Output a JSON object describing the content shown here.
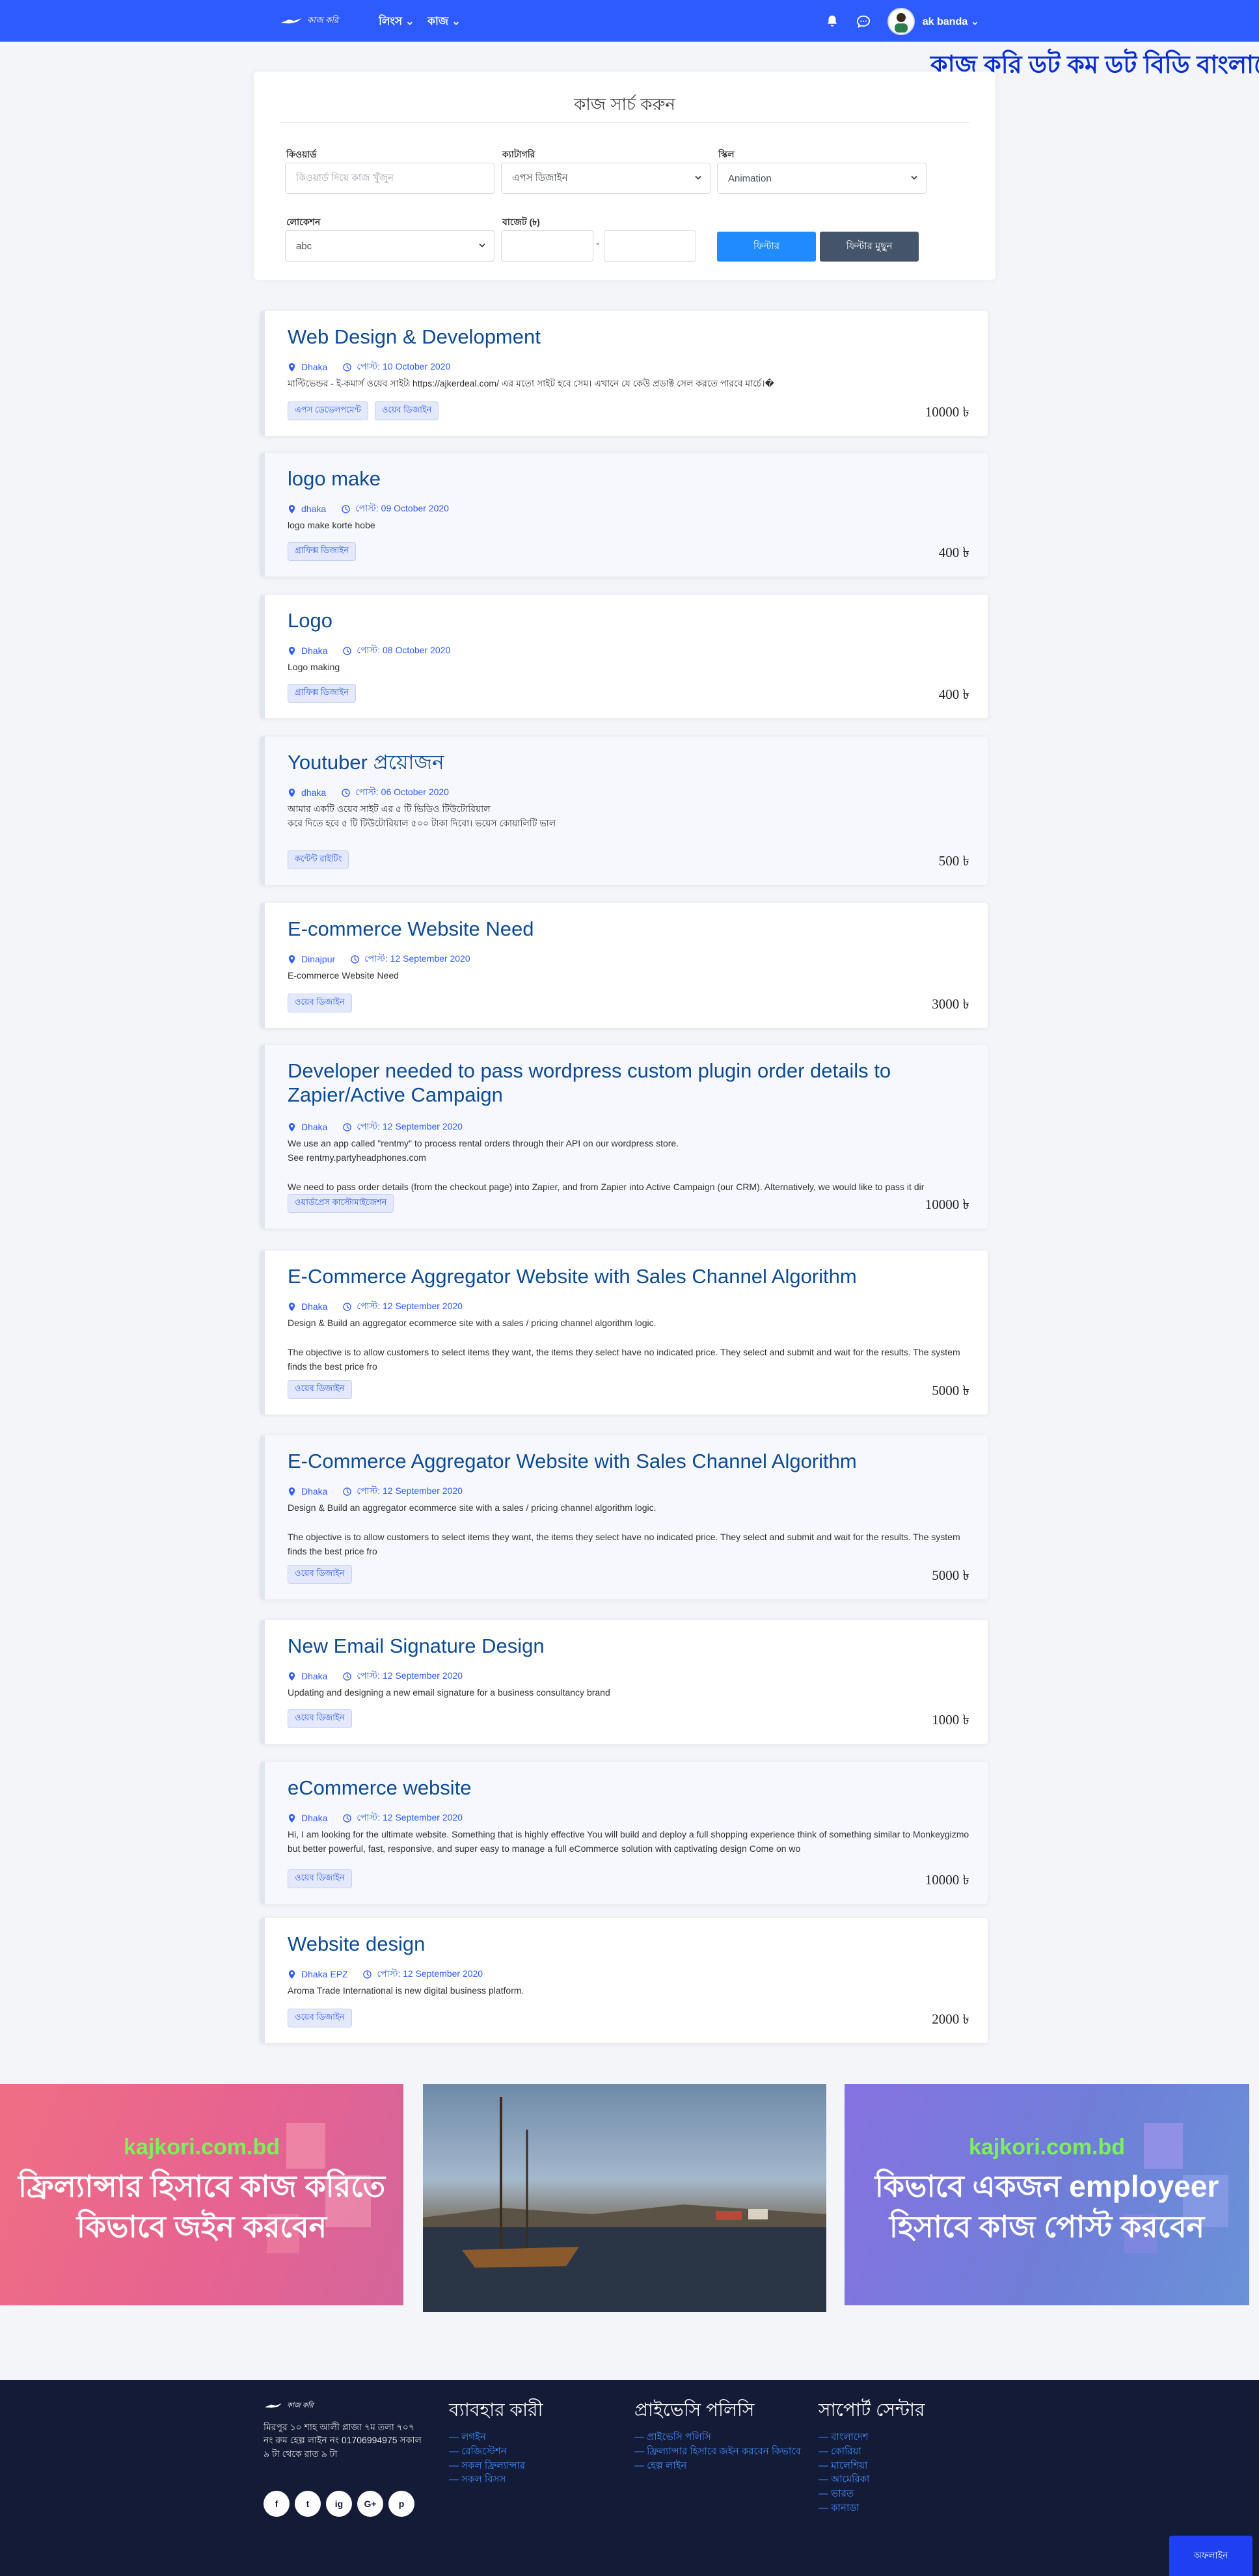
{
  "nav": {
    "logo_text": "কাজ করি",
    "menu": [
      {
        "label": "লিংস"
      },
      {
        "label": "কাজ"
      }
    ],
    "user_name": "ak banda"
  },
  "marquee": "কাজ করি ডট কম ডট বিডি বাংলাদে",
  "search": {
    "title": "কাজ সার্চ করুন",
    "keyword_label": "কিওয়ার্ড",
    "keyword_placeholder": "কিওয়ার্ড দিয়ে কাজ খুঁজুন",
    "category_label": "ক্যাটাগরি",
    "category_value": "এপস ডিজাইন",
    "skill_label": "স্কিল",
    "skill_value": "Animation",
    "location_label": "লোকেশন",
    "location_value": "abc",
    "budget_label": "বাজেট (৳)",
    "budget_sep": "-",
    "filter_btn": "ফিল্টার",
    "clear_btn": "ফিল্টার মুছুন"
  },
  "jobs": [
    {
      "title": "Web Design & Development",
      "location": "Dhaka",
      "posted": "পোস্ট: 10 October 2020",
      "desc": "মাল্টিভেন্ডর - ই-কমার্স ওয়েব সাইট৷  https://ajkerdeal.com/ এর মতো সাইট হবে সেম। এখানে যে কেউ প্রডাক্ট সেল করতে পারবে  মার্চে।�",
      "tags": [
        "এপস ডেভেলপমেন্ট",
        "ওয়েব ডিজাইন"
      ],
      "price": "10000 ৳"
    },
    {
      "title": "logo make",
      "location": "dhaka",
      "posted": "পোস্ট: 09 October 2020",
      "desc": "logo make korte hobe",
      "tags": [
        "গ্রাফিক্স ডিজাইন"
      ],
      "price": "400 ৳"
    },
    {
      "title": "Logo",
      "location": "Dhaka",
      "posted": "পোস্ট: 08 October 2020",
      "desc": "Logo making",
      "tags": [
        "গ্রাফিক্স ডিজাইন"
      ],
      "price": "400 ৳"
    },
    {
      "title": "Youtuber প্রয়োজন",
      "location": "dhaka",
      "posted": "পোস্ট: 06 October 2020",
      "desc": "আমার একটি ওয়েব সাইট এর ৫ টি ভিডিও টিউটোরিয়াল\nকরে দিতে হবে ৫ টি টিউটোরিয়াল ৫০০ টাকা দিবো। ভয়েস কোয়ালিটি ভাল",
      "tags": [
        "কন্টেন্ট রাইটিং"
      ],
      "price": "500 ৳"
    },
    {
      "title": "E-commerce Website Need",
      "location": "Dinajpur",
      "posted": "পোস্ট: 12 September 2020",
      "desc": "E-commerce Website Need",
      "tags": [
        "ওয়েব ডিজাইন"
      ],
      "price": "3000 ৳"
    },
    {
      "title": "Developer needed to pass wordpress custom plugin order details to Zapier/Active Campaign",
      "location": "Dhaka",
      "posted": "পোস্ট: 12 September 2020",
      "desc": "We use an app called \"rentmy\" to process rental orders through their API on our wordpress store.\nSee rentmy.partyheadphones.com\n\nWe need to pass order details (from the checkout page) into Zapier, and from Zapier into Active Campaign (our CRM). Alternatively, we would like to pass it dir",
      "tags": [
        "ওয়ার্ডপ্রেস কাস্টোমাইজেশন"
      ],
      "price": "10000 ৳"
    },
    {
      "title": "E-Commerce Aggregator Website with Sales Channel Algorithm",
      "location": "Dhaka",
      "posted": "পোস্ট: 12 September 2020",
      "desc": "Design & Build an aggregator ecommerce site with a sales / pricing channel algorithm logic.\n\nThe objective is to allow customers to select items they want, the items they select have no indicated price. They select and submit and wait for the results. The system finds the best price fro",
      "tags": [
        "ওয়েব ডিজাইন"
      ],
      "price": "5000 ৳"
    },
    {
      "title": "E-Commerce Aggregator Website with Sales Channel Algorithm",
      "location": "Dhaka",
      "posted": "পোস্ট: 12 September 2020",
      "desc": "Design & Build an aggregator ecommerce site with a sales / pricing channel algorithm logic.\n\nThe objective is to allow customers to select items they want, the items they select have no indicated price. They select and submit and wait for the results. The system finds the best price fro",
      "tags": [
        "ওয়েব ডিজাইন"
      ],
      "price": "5000 ৳"
    },
    {
      "title": "New Email Signature Design",
      "location": "Dhaka",
      "posted": "পোস্ট: 12 September 2020",
      "desc": "Updating and designing a new email signature for a business consultancy brand",
      "tags": [
        "ওয়েব ডিজাইন"
      ],
      "price": "1000 ৳"
    },
    {
      "title": "eCommerce website",
      "location": "Dhaka",
      "posted": "পোস্ট: 12 September 2020",
      "desc": "Hi, I am looking for the ultimate website. Something that is highly effective You will build and deploy a full shopping experience think of something similar to Monkeygizmo but better powerful, fast, responsive, and super easy to manage a full eCommerce solution with captivating design Come on wo",
      "tags": [
        "ওয়েব ডিজাইন"
      ],
      "price": "10000 ৳"
    },
    {
      "title": "Website design",
      "location": "Dhaka EPZ",
      "posted": "পোস্ট: 12 September 2020",
      "desc": "Aroma Trade International is new digital business platform.",
      "tags": [
        "ওয়েব ডিজাইন"
      ],
      "price": "2000 ৳"
    }
  ],
  "banners": {
    "left_site": "kajkori.com.bd",
    "left_line1": "ফ্রিল্যান্সার হিসাবে কাজ করিতে",
    "left_line2": "কিভাবে জইন করবেন",
    "right_site": "kajkori.com.bd",
    "right_line1": "কিভাবে একজন employeer",
    "right_line2": "হিসাবে কাজ পোস্ট করবেন"
  },
  "footer": {
    "logo_text": "কাজ করি",
    "address": "মিরপুর ১০ শাহ আলী প্লাজা ৭ম তলা ৭০৭ নং রুম হেল্প লাইন নং 01706994975 সকাল ৯ টা থেকে রাত ৯ টা",
    "social": [
      "f",
      "t",
      "ig",
      "G+",
      "p"
    ],
    "col1_title": "ব্যাবহার কারী",
    "col1_items": [
      "লগইন",
      "রেজিস্টেশন",
      "সকল ফ্রিল্যান্সার",
      "সকল বিসস"
    ],
    "col2_title": "প্রাইভেসি পলিসি",
    "col2_items": [
      "প্রাইভেসি পলিসি",
      "ফ্রিল্যান্সার হিসাবে জইন করবেন কিভাবে",
      "হেল্প লাইন"
    ],
    "col3_title": "সাপোর্ট সেন্টার",
    "col3_items": [
      "বাংলাদেশ",
      "কোরিয়া",
      "মালেশিয়া",
      "আমেরিকা",
      "ভারত",
      "কানাডা"
    ],
    "offline": "অফলাইন"
  }
}
